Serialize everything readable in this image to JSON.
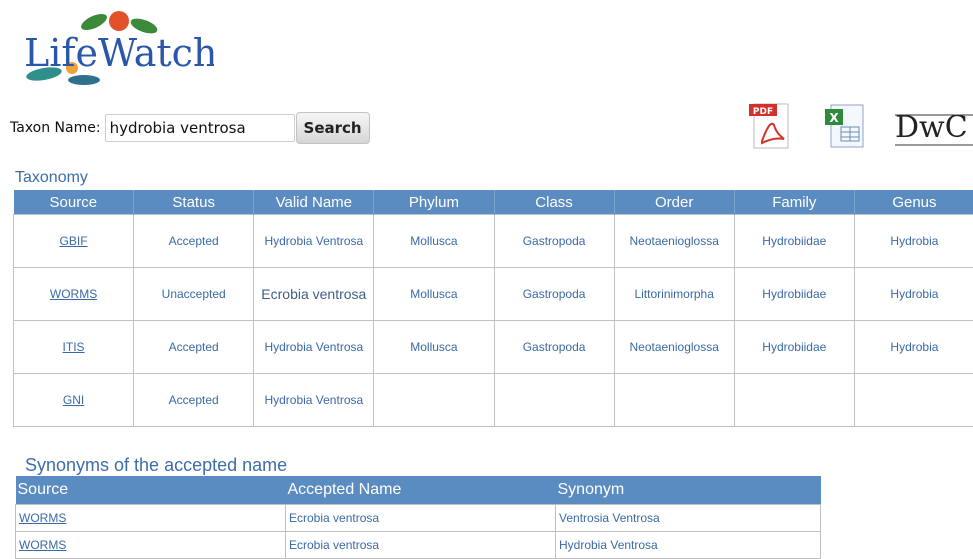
{
  "logo": {
    "text": "LifeWatch"
  },
  "search": {
    "label": "Taxon Name:",
    "value": "hydrobia ventrosa",
    "button": "Search"
  },
  "exports": [
    {
      "name": "pdf",
      "label": "PDF"
    },
    {
      "name": "excel",
      "label": ""
    },
    {
      "name": "dwc",
      "label": "DwC"
    }
  ],
  "taxonomy": {
    "title": "Taxonomy",
    "columns": [
      "Source",
      "Status",
      "Valid Name",
      "Phylum",
      "Class",
      "Order",
      "Family",
      "Genus"
    ],
    "rows": [
      [
        "GBIF",
        "Accepted",
        "Hydrobia Ventrosa",
        "Mollusca",
        "Gastropoda",
        "Neotaenioglossa",
        "Hydrobiidae",
        "Hydrobia"
      ],
      [
        "WORMS",
        "Unaccepted",
        "Ecrobia ventrosa",
        "Mollusca",
        "Gastropoda",
        "Littorinimorpha",
        "Hydrobiidae",
        "Hydrobia"
      ],
      [
        "ITIS",
        "Accepted",
        "Hydrobia Ventrosa",
        "Mollusca",
        "Gastropoda",
        "Neotaenioglossa",
        "Hydrobiidae",
        "Hydrobia"
      ],
      [
        "GNI",
        "Accepted",
        "Hydrobia Ventrosa",
        "",
        "",
        "",
        "",
        ""
      ]
    ]
  },
  "synonyms": {
    "title": "Synonyms of the accepted name",
    "columns": [
      "Source",
      "Accepted Name",
      "Synonym"
    ],
    "rows": [
      [
        "WORMS",
        "Ecrobia ventrosa",
        "Ventrosia Ventrosa"
      ],
      [
        "WORMS",
        "Ecrobia ventrosa",
        "Hydrobia Ventrosa"
      ]
    ]
  }
}
